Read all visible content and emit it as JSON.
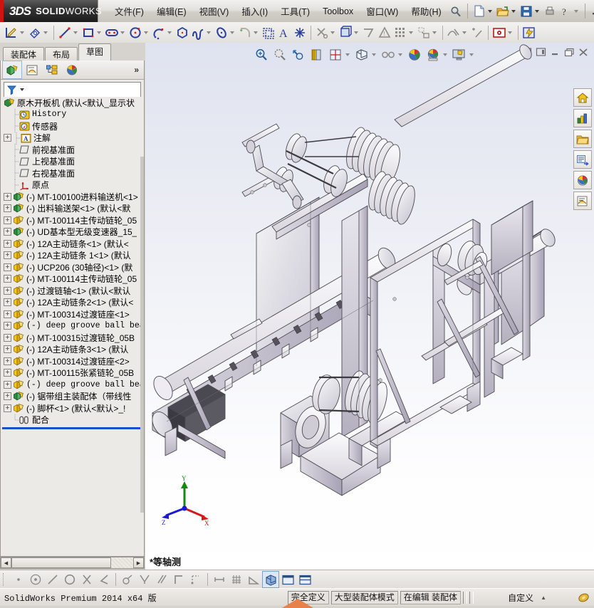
{
  "app": {
    "brand_ds": "3DS",
    "brand_name_bold": "SOLID",
    "brand_name_thin": "WORKS",
    "accent_red": "#cc1417",
    "accent_blue": "#1a4fcb"
  },
  "menubar": {
    "items": [
      {
        "label": "文件(F)",
        "name": "menu-file"
      },
      {
        "label": "编辑(E)",
        "name": "menu-edit"
      },
      {
        "label": "视图(V)",
        "name": "menu-view"
      },
      {
        "label": "插入(I)",
        "name": "menu-insert"
      },
      {
        "label": "工具(T)",
        "name": "menu-tools"
      },
      {
        "label": "Toolbox",
        "name": "menu-toolbox"
      },
      {
        "label": "窗口(W)",
        "name": "menu-window"
      },
      {
        "label": "帮助(H)",
        "name": "menu-help"
      }
    ],
    "quick_icons": [
      "search-icon",
      "new-document-icon",
      "open-folder-icon",
      "save-icon",
      "print-icon",
      "help-icon"
    ],
    "window_controls": [
      "minimize-icon",
      "restore-icon",
      "close-icon"
    ]
  },
  "sketch_toolbar": {
    "icons": [
      "sketch-icon",
      "smart-dimension-icon",
      "line-icon",
      "rectangle-icon",
      "slot-icon",
      "circle-icon",
      "arc-3point-icon",
      "polygon-icon",
      "spline-icon",
      "ellipse-icon",
      "fillet-icon",
      "offset-entities-icon",
      "mirror-entities-icon",
      "text-icon",
      "point-icon",
      "trim-entities-icon",
      "convert-entities-icon",
      "linear-pattern-icon",
      "display-delete-relations-icon",
      "grid-icon",
      "move-entities-icon",
      "repair-sketch-icon",
      "quick-snaps-icon",
      "rapid-sketch-icon",
      "instant3d-icon"
    ]
  },
  "tabs": [
    {
      "label": "装配体",
      "name": "tab-assembly",
      "active": false
    },
    {
      "label": "布局",
      "name": "tab-layout",
      "active": false
    },
    {
      "label": "草图",
      "name": "tab-sketch",
      "active": true
    }
  ],
  "tree_panel": {
    "tab_icons": [
      "feature-manager-icon",
      "property-manager-icon",
      "configuration-manager-icon",
      "display-manager-icon"
    ],
    "overflow_label": "»",
    "filter_icon": "filter-funnel-icon",
    "filter_placeholder": "",
    "root": {
      "label": "原木开板机   (默认<默认_显示状",
      "icon": "assembly-icon"
    },
    "items": [
      {
        "label": "History",
        "icon": "history-icon",
        "expand": "none",
        "mono": true
      },
      {
        "label": "传感器",
        "icon": "sensor-icon",
        "expand": "none",
        "mono": false
      },
      {
        "label": "注解",
        "icon": "annotation-icon",
        "expand": "plus",
        "mono": false
      },
      {
        "label": "前视基准面",
        "icon": "plane-icon",
        "expand": "none",
        "mono": false
      },
      {
        "label": "上视基准面",
        "icon": "plane-icon",
        "expand": "none",
        "mono": false
      },
      {
        "label": "右视基准面",
        "icon": "plane-icon",
        "expand": "none",
        "mono": false
      },
      {
        "label": "原点",
        "icon": "origin-icon",
        "expand": "none",
        "mono": false
      },
      {
        "label": "(-) MT-100100进料输送机<1>",
        "icon": "part-green-icon",
        "expand": "plus",
        "mono": false
      },
      {
        "label": "(-) 出料输送架<1>  (默认<默",
        "icon": "part-green-icon",
        "expand": "plus",
        "mono": false
      },
      {
        "label": "(-) MT-100114主传动链轮_05",
        "icon": "part-icon",
        "expand": "plus",
        "mono": false
      },
      {
        "label": "(-) UD基本型无级变速器_15_",
        "icon": "part-green-icon",
        "expand": "plus",
        "mono": false
      },
      {
        "label": "(-) 12A主动链条<1>  (默认<",
        "icon": "part-icon",
        "expand": "plus",
        "mono": false
      },
      {
        "label": "(-) 12A主动链条 1<1>  (默认",
        "icon": "part-icon",
        "expand": "plus",
        "mono": false
      },
      {
        "label": "(-) UCP206 (30轴径)<1>  (默",
        "icon": "part-icon",
        "expand": "plus",
        "mono": false
      },
      {
        "label": "(-) MT-100114主传动链轮_05",
        "icon": "part-icon",
        "expand": "plus",
        "mono": false
      },
      {
        "label": "(-) 过渡链轴<1>  (默认<默认",
        "icon": "part-icon",
        "expand": "plus",
        "mono": false
      },
      {
        "label": "(-) 12A主动链条2<1>  (默认<",
        "icon": "part-icon",
        "expand": "plus",
        "mono": false
      },
      {
        "label": "(-) MT-100314过渡链座<1>",
        "icon": "part-icon",
        "expand": "plus",
        "mono": false
      },
      {
        "label": "(-) deep groove ball bear",
        "icon": "part-icon",
        "expand": "plus",
        "mono": true
      },
      {
        "label": "(-) MT-100315过渡链轮_05B",
        "icon": "part-icon",
        "expand": "plus",
        "mono": false
      },
      {
        "label": "(-) 12A主动链条3<1>  (默认",
        "icon": "part-icon",
        "expand": "plus",
        "mono": false
      },
      {
        "label": "(-) MT-100314过渡链座<2>",
        "icon": "part-icon",
        "expand": "plus",
        "mono": false
      },
      {
        "label": "(-) MT-100115张紧链轮_05B",
        "icon": "part-icon",
        "expand": "plus",
        "mono": false
      },
      {
        "label": "(-) deep groove ball bear",
        "icon": "part-icon",
        "expand": "plus",
        "mono": true
      },
      {
        "label": "(-) 锯带组主装配体（带线性",
        "icon": "part-green-icon",
        "expand": "plus",
        "mono": false
      },
      {
        "label": "(-) 脚杯<1>  (默认<默认>_!",
        "icon": "part-icon",
        "expand": "plus",
        "mono": false
      },
      {
        "label": "配合",
        "icon": "mates-icon",
        "expand": "none",
        "mono": false
      }
    ]
  },
  "viewport": {
    "view_toolbar_icons": [
      "zoom-to-fit-icon",
      "zoom-to-area-icon",
      "previous-view-icon",
      "section-view-icon",
      "view-orientation-icon",
      "display-style-icon",
      "hide-show-items-icon",
      "appearance-icon",
      "scene-icon",
      "view-settings-icon"
    ],
    "window_icons": [
      "tile-left-icon",
      "tile-right-icon",
      "minimize-icon",
      "restore-icon",
      "close-icon"
    ],
    "view_name": "*等轴测",
    "axes": {
      "x": "X",
      "y": "Y",
      "z": "Z",
      "x_color": "#d11a1a",
      "y_color": "#138a13",
      "z_color": "#1a1ad1"
    },
    "background_top": "#dfe3ef",
    "background_bottom": "#ffffff"
  },
  "task_panel": {
    "items": [
      {
        "name": "solidworks-resources-icon",
        "label": "SolidWorks 资源"
      },
      {
        "name": "design-library-icon",
        "label": "设计库"
      },
      {
        "name": "file-explorer-icon",
        "label": "文件探索器"
      },
      {
        "name": "view-palette-icon",
        "label": "视图调色板"
      },
      {
        "name": "appearances-scenes-icon",
        "label": "外观、布景和贴图"
      },
      {
        "name": "custom-properties-icon",
        "label": "自定义属性"
      }
    ]
  },
  "bottom_toolbar": {
    "icons": [
      "point-select-icon",
      "concentric-icon",
      "line-select-icon",
      "circle-select-icon",
      "intersection-icon",
      "angle-select-icon",
      "tangent-icon",
      "perpendicular-icon",
      "parallel-icon",
      "corner-icon",
      "midpoint-icon",
      "length-snap-icon",
      "grid-snap-icon",
      "angle-snap-icon",
      "shaded-isometric-icon",
      "single-view-icon",
      "two-view-icon"
    ],
    "selected": "shaded-isometric-icon"
  },
  "statusbar": {
    "product": "SolidWorks Premium 2014 x64 版",
    "cells": [
      "完全定义",
      "大型装配体模式",
      "在编辑 装配体"
    ],
    "custom_label": "自定义",
    "custom_caret": "▲",
    "trailing_icon": "sw-badge-icon"
  }
}
